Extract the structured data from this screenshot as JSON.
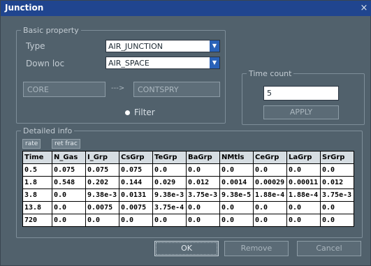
{
  "window": {
    "title": "Junction",
    "close_glyph": "×"
  },
  "basic_property": {
    "legend": "Basic property",
    "type_label": "Type",
    "down_label": "Down loc",
    "type_value": "AIR_JUNCTION",
    "down_value": "AIR_SPACE",
    "from_value": "CORE",
    "arrow_text": "--->",
    "to_value": "CONTSPRY",
    "filter_label": "Filter"
  },
  "time_count": {
    "legend": "Time count",
    "value": "5",
    "apply_label": "APPLY"
  },
  "detailed_info": {
    "legend": "Detailed info",
    "tabs": [
      {
        "label": "rate"
      },
      {
        "label": "ret frac"
      }
    ],
    "columns": [
      "Time",
      "N_Gas",
      "I_Grp",
      "CsGrp",
      "TeGrp",
      "BaGrp",
      "NMtls",
      "CeGrp",
      "LaGrp",
      "SrGrp"
    ],
    "rows": [
      [
        "0.5",
        "0.075",
        "0.075",
        "0.075",
        "0.0",
        "0.0",
        "0.0",
        "0.0",
        "0.0",
        "0.0"
      ],
      [
        "1.8",
        "0.548",
        "0.202",
        "0.144",
        "0.029",
        "0.012",
        "0.0014",
        "0.00029",
        "0.00011",
        "0.012"
      ],
      [
        "3.8",
        "0.0",
        "9.38e-3",
        "0.0131",
        "9.38e-3",
        "3.75e-3",
        "9.38e-5",
        "1.88e-4",
        "1.88e-4",
        "3.75e-3"
      ],
      [
        "13.8",
        "0.0",
        "0.0075",
        "0.0075",
        "3.75e-4",
        "0.0",
        "0.0",
        "0.0",
        "0.0",
        "0.0"
      ],
      [
        "720",
        "0.0",
        "0.0",
        "0.0",
        "0.0",
        "0.0",
        "0.0",
        "0.0",
        "0.0",
        "0.0"
      ]
    ]
  },
  "buttons": {
    "ok": "OK",
    "remove": "Remove",
    "cancel": "Cancel"
  },
  "colors": {
    "titlebar": "#20458f",
    "background": "#51616c",
    "combo_arrow": "#2a62b8"
  },
  "icons": {
    "close": "close-icon",
    "combo_arrow": "chevron-down-icon",
    "filter_radio": "radio-icon"
  }
}
